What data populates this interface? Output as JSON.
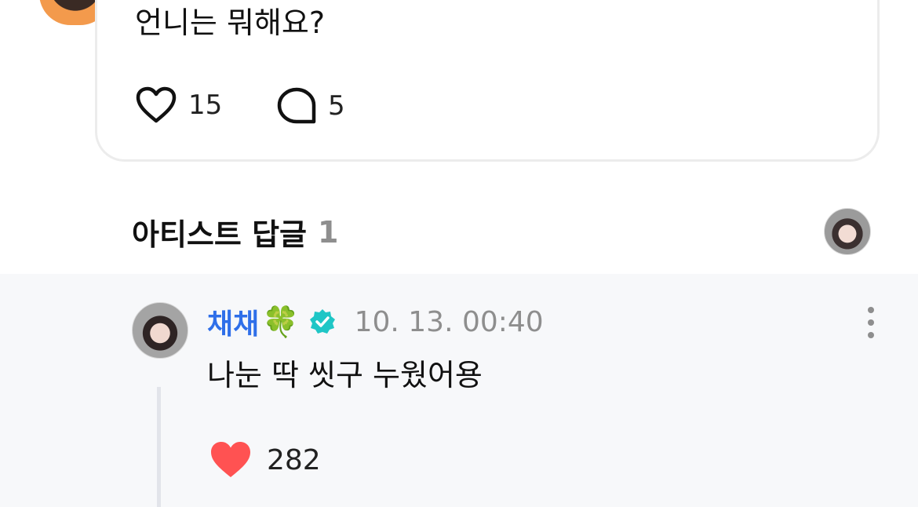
{
  "post": {
    "text": "언니는 뭐해요?",
    "like_count": "15",
    "comment_count": "5"
  },
  "artist_replies": {
    "title": "아티스트 답글",
    "count": "1"
  },
  "reply": {
    "author": "채채",
    "author_emoji": "🍀",
    "timestamp": "10. 13. 00:40",
    "text": "나눈 딱 씻구 누웠어용",
    "like_count": "282"
  },
  "colors": {
    "author": "#2f6fe9",
    "verified_badge": "#1fc6c6",
    "liked_heart": "#ff5252",
    "reply_background": "#f7f8fa"
  },
  "icons": {
    "like": "heart-outline-icon",
    "comment": "speech-bubble-icon",
    "verified": "verified-badge-icon",
    "more": "more-vertical-icon",
    "liked": "heart-filled-icon"
  }
}
